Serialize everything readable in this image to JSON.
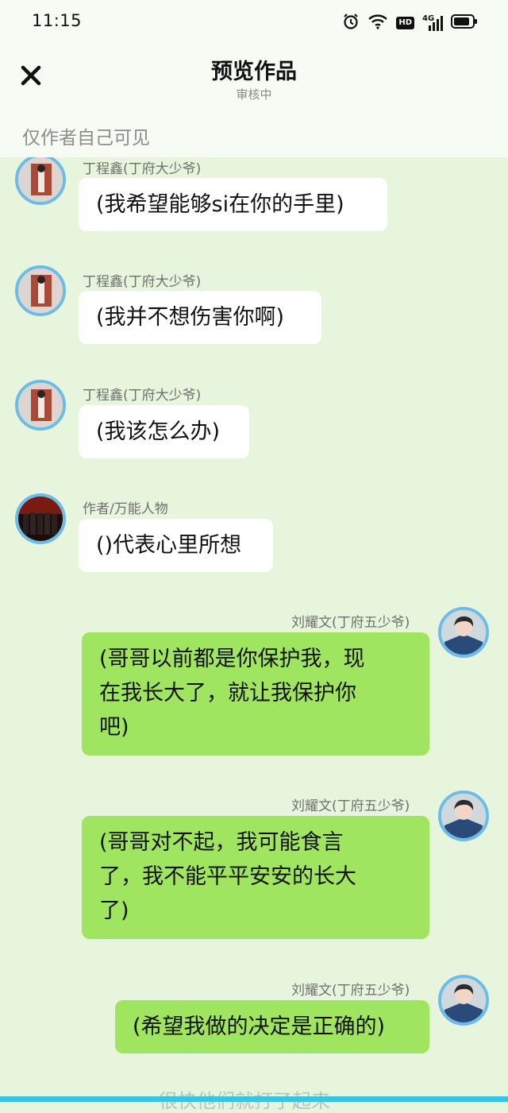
{
  "status_bar": {
    "time": "11:15",
    "icons": [
      "alarm-icon",
      "wifi-icon",
      "hd-icon",
      "signal-4g-icon",
      "battery-icon"
    ],
    "hd_label": "HD",
    "net_label": "4G"
  },
  "header": {
    "close_icon": "close-icon",
    "title": "预览作品",
    "subtitle": "审核中"
  },
  "visibility_note": "仅作者自己可见",
  "messages": [
    {
      "side": "left",
      "name": "丁程鑫(丁府大少爷)",
      "text": "(我希望能够si在你的手里)"
    },
    {
      "side": "left",
      "name": "丁程鑫(丁府大少爷)",
      "text": "(我并不想伤害你啊)"
    },
    {
      "side": "left",
      "name": "丁程鑫(丁府大少爷)",
      "text": "(我该怎么办)"
    },
    {
      "side": "left",
      "name": "作者/万能人物",
      "text": "()代表心里所想"
    },
    {
      "side": "right",
      "name": "刘耀文(丁府五少爷)",
      "lines": [
        "(哥哥以前都是你保护我，现",
        "在我长大了，就让我保护你",
        "吧)"
      ]
    },
    {
      "side": "right",
      "name": "刘耀文(丁府五少爷)",
      "lines": [
        "(哥哥对不起，我可能食言",
        "了，我不能平平安安的长大",
        "了)"
      ]
    },
    {
      "side": "right",
      "name": "刘耀文(丁府五少爷)",
      "text": "(希望我做的决定是正确的)"
    }
  ],
  "bottom_peek_text": "很快他们就打了起来",
  "colors": {
    "chat_background": "#e7f5dd",
    "header_background": "#f6fbf3",
    "left_bubble": "#ffffff",
    "right_bubble": "#9fe55f",
    "avatar_ring": "#6cbce9"
  }
}
